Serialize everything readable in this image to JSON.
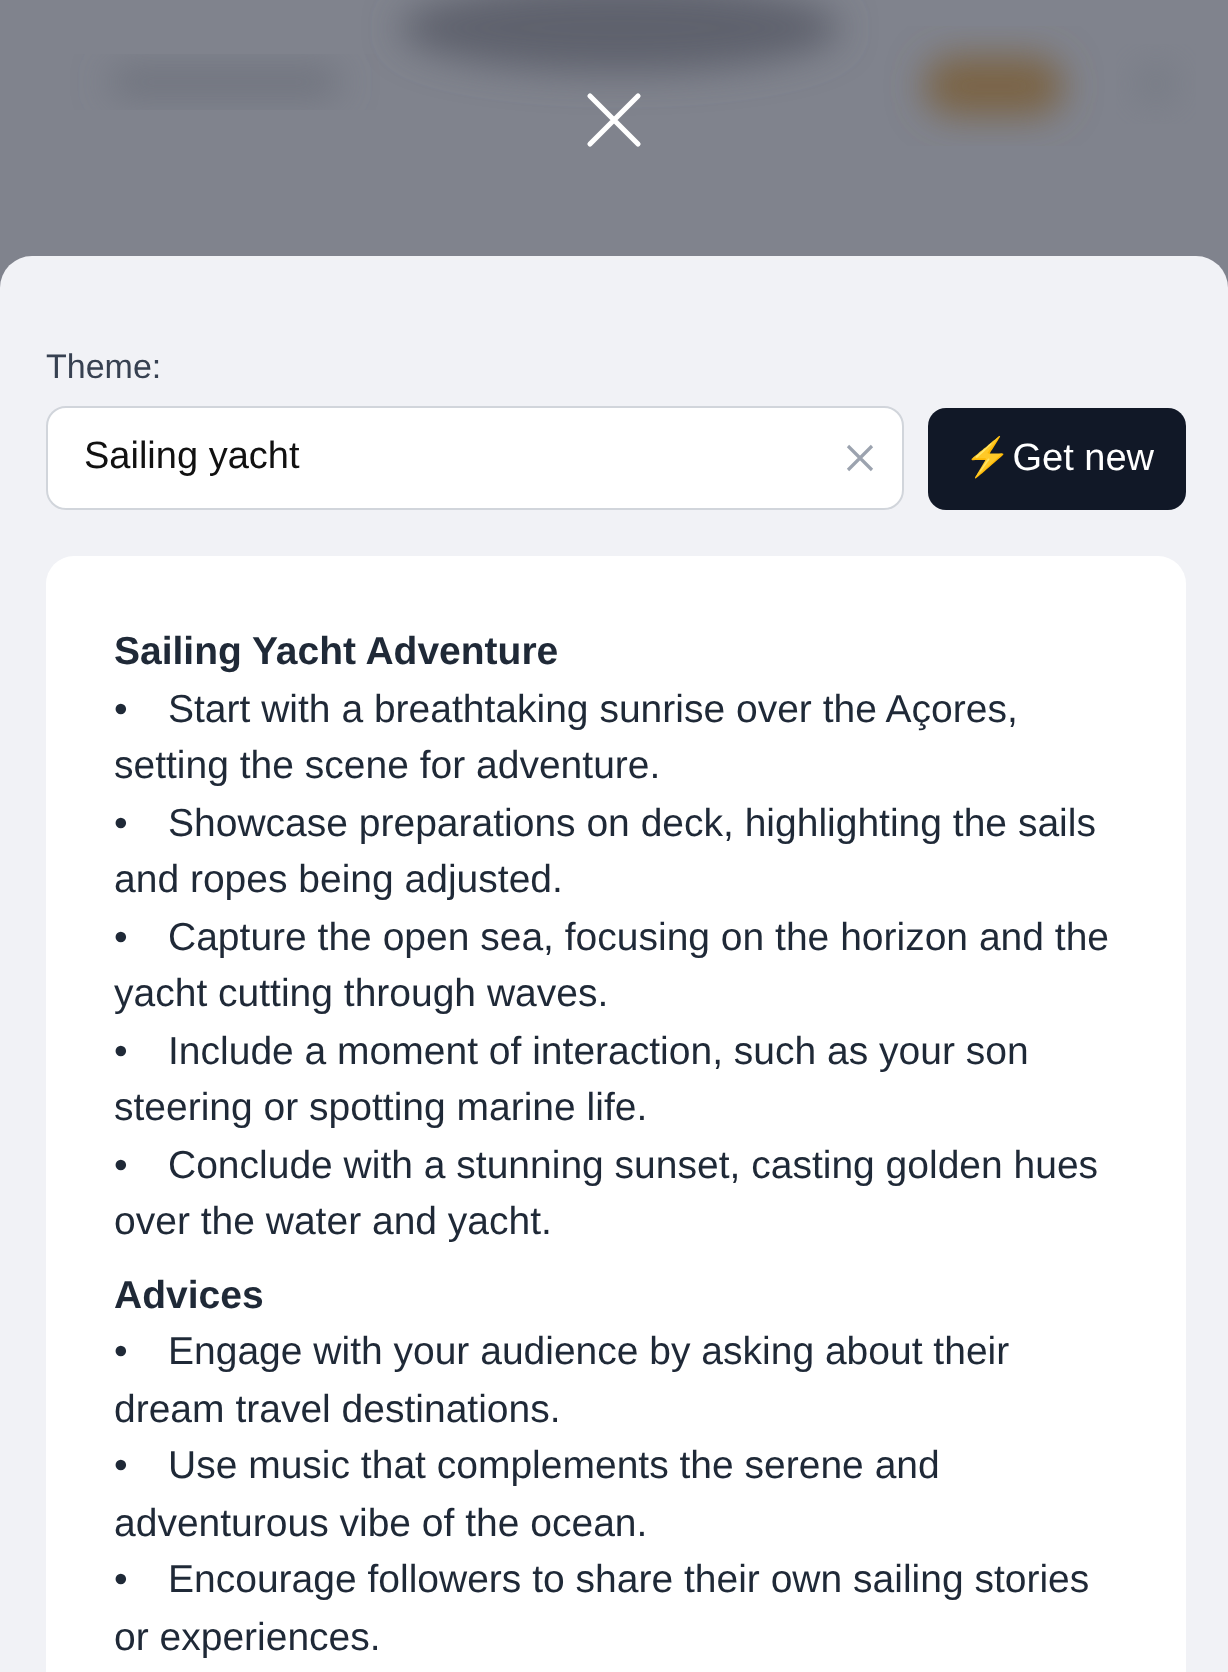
{
  "theme_field": {
    "label": "Theme:",
    "value": "Sailing yacht"
  },
  "get_new_button": {
    "icon": "⚡",
    "label": "Get new"
  },
  "sections": [
    {
      "title": "Sailing Yacht Adventure",
      "items": [
        {
          "bullet": "•",
          "text": "Start with a breathtaking sunrise over the Açores, setting the scene for adventure."
        },
        {
          "bullet": "•",
          "text": "Showcase preparations on deck, highlighting the sails and ropes being adjusted."
        },
        {
          "bullet": "•",
          "text": "Capture the open sea, focusing on the horizon and the yacht cutting through waves."
        },
        {
          "bullet": "•",
          "text": "Include a moment of interaction, such as your son steering or spotting marine life."
        },
        {
          "bullet": "•",
          "text": "Conclude with a stunning sunset, casting golden hues over the water and yacht."
        }
      ]
    },
    {
      "title": "Advices",
      "items": [
        {
          "bullet": "•",
          "text": "Engage with your audience by asking about their dream travel destinations."
        },
        {
          "bullet": "•",
          "text": "Use music that complements the serene and adventurous vibe of the ocean."
        },
        {
          "bullet": "•",
          "text": "Encourage followers to share their own sailing stories or experiences."
        }
      ]
    }
  ]
}
